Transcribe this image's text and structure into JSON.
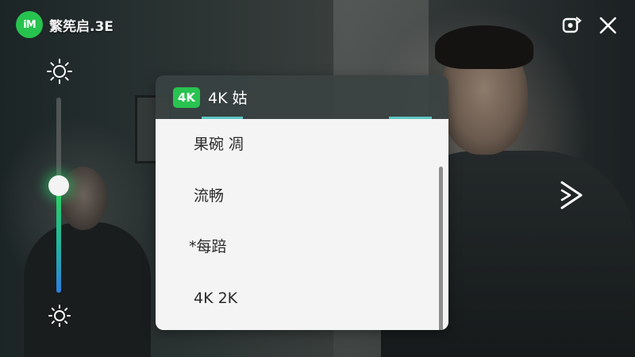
{
  "app": {
    "logo_badge": "iM",
    "logo_text": "繁筅启.3E"
  },
  "top_bar": {
    "rotate_icon": "screen-rotate-icon",
    "close_icon": "close-icon"
  },
  "brightness": {
    "level": 0.55,
    "max_icon": "sun-icon",
    "min_icon": "sun-icon"
  },
  "side": {
    "play_icon": "play-icon"
  },
  "quality_panel": {
    "badge": "4K",
    "title": "4K 姑",
    "options": [
      {
        "label": "果碗 凋"
      },
      {
        "label": "流畅"
      },
      {
        "label": "*每踣"
      },
      {
        "label": "4K 2K"
      }
    ]
  },
  "colors": {
    "accent_green": "#28c350",
    "slider_gradient_top": "#2fd35a",
    "slider_gradient_bottom": "#2c7fe0",
    "panel_bg": "#f4f4f4",
    "panel_header_bg": "#3a4242"
  }
}
